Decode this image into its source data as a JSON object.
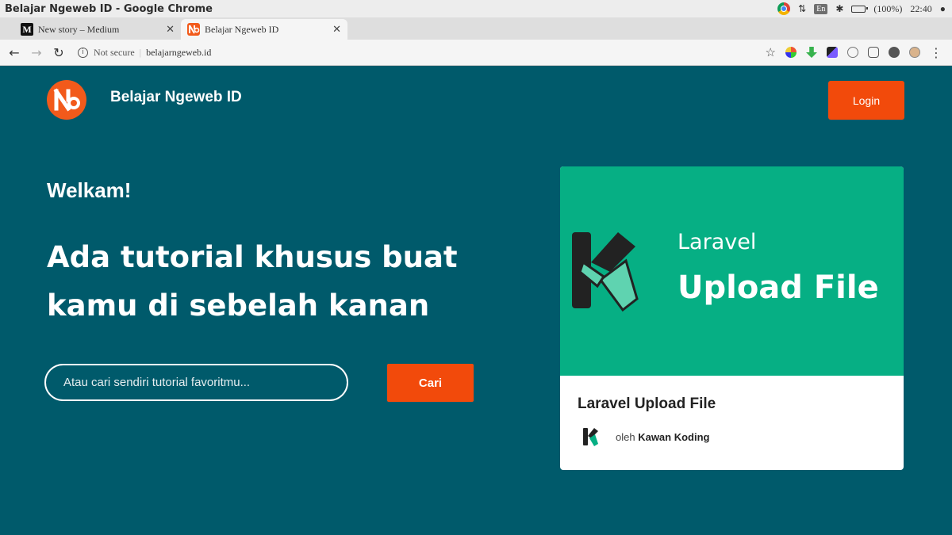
{
  "os_bar": {
    "window_title": "Belajar Ngeweb ID - Google Chrome",
    "language": "En",
    "battery": "(100%)",
    "clock": "22:40"
  },
  "tabs": [
    {
      "label": "New story – Medium",
      "favicon": "medium-icon",
      "active": false
    },
    {
      "label": "Belajar Ngeweb ID",
      "favicon": "ngeweb-icon",
      "active": true
    }
  ],
  "address_bar": {
    "security_text": "Not secure",
    "url": "belajarngeweb.id"
  },
  "header": {
    "site_name": "Belajar Ngeweb ID",
    "login_label": "Login"
  },
  "hero": {
    "welcome": "Welkam!",
    "headline": "Ada tutorial khusus buat kamu di sebelah kanan",
    "search_placeholder": "Atau cari sendiri tutorial favoritmu...",
    "search_button": "Cari"
  },
  "card": {
    "banner_small": "Laravel",
    "banner_big": "Upload File",
    "title": "Laravel Upload File",
    "author_prefix": "oleh",
    "author_name": "Kawan Koding"
  },
  "colors": {
    "page_bg": "#005a6b",
    "accent": "#f24a0b",
    "banner": "#06af84"
  }
}
